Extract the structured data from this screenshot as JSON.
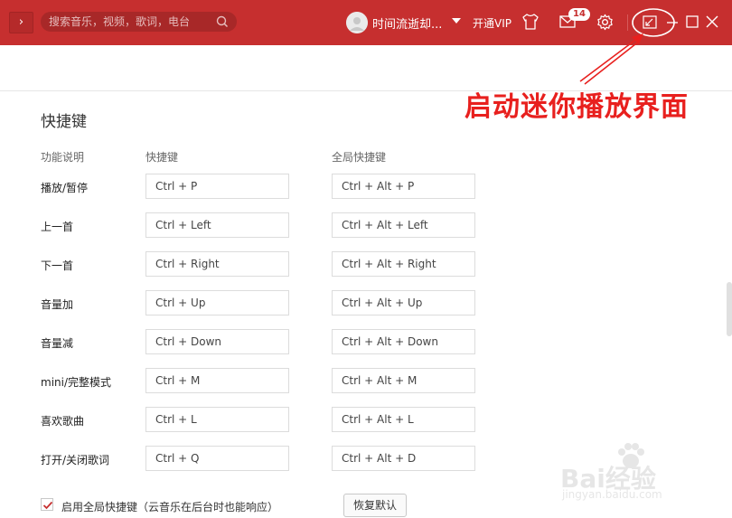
{
  "header": {
    "search_placeholder": "搜索音乐，视频，歌词，电台",
    "username": "时间流逝却...",
    "vip_label": "开通VIP",
    "mail_badge": "14"
  },
  "annotation": {
    "text": "启动迷你播放界面"
  },
  "settings": {
    "section_title": "快捷键",
    "columns": {
      "function": "功能说明",
      "shortcut": "快捷键",
      "global": "全局快捷键"
    },
    "rows": [
      {
        "label": "播放/暂停",
        "shortcut": "Ctrl + P",
        "global": "Ctrl + Alt + P"
      },
      {
        "label": "上一首",
        "shortcut": "Ctrl + Left",
        "global": "Ctrl + Alt + Left"
      },
      {
        "label": "下一首",
        "shortcut": "Ctrl + Right",
        "global": "Ctrl + Alt + Right"
      },
      {
        "label": "音量加",
        "shortcut": "Ctrl + Up",
        "global": "Ctrl + Alt + Up"
      },
      {
        "label": "音量减",
        "shortcut": "Ctrl + Down",
        "global": "Ctrl + Alt + Down"
      },
      {
        "label": "mini/完整模式",
        "shortcut": "Ctrl + M",
        "global": "Ctrl + Alt + M"
      },
      {
        "label": "喜欢歌曲",
        "shortcut": "Ctrl + L",
        "global": "Ctrl + Alt + L"
      },
      {
        "label": "打开/关闭歌词",
        "shortcut": "Ctrl + Q",
        "global": "Ctrl + Alt + D"
      }
    ],
    "enable_global_label": "启用全局快捷键（云音乐在后台时也能响应）",
    "enable_global_checked": true,
    "restore_button": "恢复默认"
  },
  "watermark": {
    "brand": "Bai经验",
    "url": "jingyan.baidu.com"
  },
  "colors": {
    "brand_red": "#c62f2f",
    "annotation_red": "#e8201e"
  }
}
